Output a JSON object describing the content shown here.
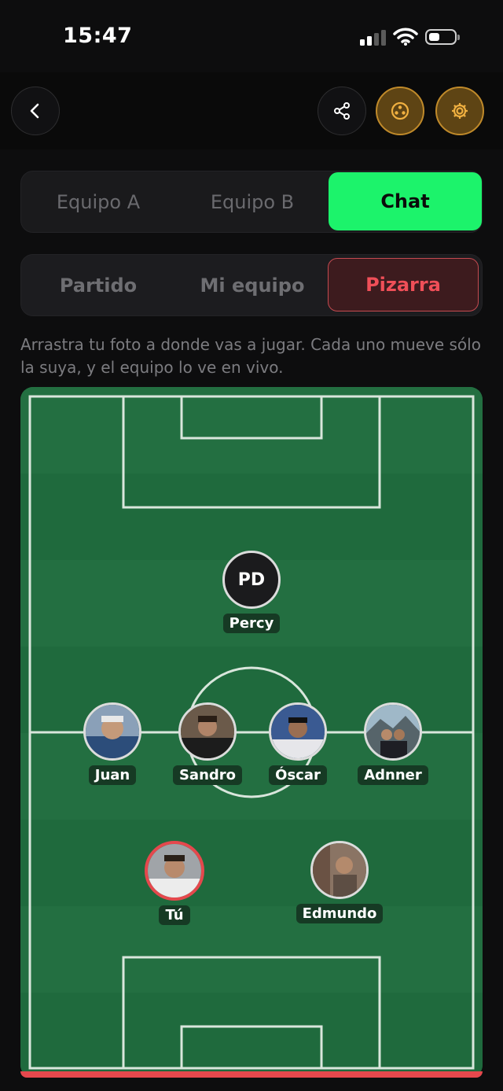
{
  "status_bar": {
    "time": "15:47"
  },
  "top_tabs": [
    {
      "label": "Equipo A",
      "active": false
    },
    {
      "label": "Equipo B",
      "active": false
    },
    {
      "label": "Chat",
      "active": true
    }
  ],
  "sub_tabs": [
    {
      "label": "Partido",
      "active": false
    },
    {
      "label": "Mi equipo",
      "active": false
    },
    {
      "label": "Pizarra",
      "active": true
    }
  ],
  "hint": "Arrastra tu foto a donde vas a jugar. Cada uno mueve sólo la suya, y el equipo lo ve en vivo.",
  "players": [
    {
      "name": "Percy",
      "initials": "PD"
    },
    {
      "name": "Juan"
    },
    {
      "name": "Sandro"
    },
    {
      "name": "Óscar"
    },
    {
      "name": "Adnner"
    },
    {
      "name": "Tú",
      "is_me": true
    },
    {
      "name": "Edmundo"
    }
  ],
  "colors": {
    "accent_green": "#1cf36b",
    "accent_red": "#ef4f58",
    "gold": "#c08a2a",
    "pitch": "#1f6b3c"
  }
}
